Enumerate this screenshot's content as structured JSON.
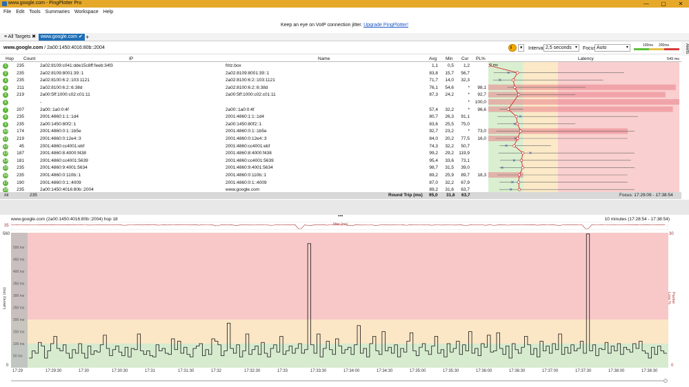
{
  "window": {
    "title": "www.google.com - PingPlotter Pro",
    "controls": [
      "—",
      "▢",
      "✕"
    ]
  },
  "menu": [
    "File",
    "Edit",
    "Tools",
    "Summaries",
    "Workspace",
    "Help"
  ],
  "promo": {
    "text": "Keep an eye on VoIP connection jitter.",
    "link": "Upgrade PingPlotter!"
  },
  "tabs": {
    "all_targets": "All Targets",
    "active": "www.google.com"
  },
  "toolbar": {
    "target_host": "www.google.com",
    "target_ip": "/ 2a00:1450:4016:80b::2004",
    "interval_label": "Interval",
    "interval_value": "2,5 seconds",
    "focus_label": "Focus",
    "focus_value": "Auto",
    "legend_100": "100ms",
    "legend_200": "200ms",
    "alerts": "Alerts"
  },
  "table": {
    "headers": {
      "hop": "Hop",
      "count": "Count",
      "ip": "IP",
      "name": "Name",
      "avg": "Avg",
      "min": "Min",
      "cur": "Cur",
      "pl": "PL%",
      "latency": "Latency",
      "lat_min": "0 ms",
      "lat_max": "549 ms"
    },
    "rows": [
      {
        "hop": "1",
        "count": "235",
        "ip": "2a02:8109:c041:dde15c8ff:feeb:34f3",
        "name": "fritz.box",
        "avg": "1,1",
        "min": "0,5",
        "cur": "1,2",
        "pl": "",
        "avg_ms": 1.1,
        "min_ms": 0.5,
        "cur_ms": 1.2,
        "max_ms": 6,
        "pl_pct": 0
      },
      {
        "hop": "2",
        "count": "235",
        "ip": "2a02:8109:8001:39::1",
        "name": "2a02:8109:8001:39::1",
        "avg": "83,8",
        "min": "15,7",
        "cur": "56,7",
        "pl": "",
        "avg_ms": 83.8,
        "min_ms": 15.7,
        "cur_ms": 56.7,
        "max_ms": 390,
        "pl_pct": 0
      },
      {
        "hop": "3",
        "count": "235",
        "ip": "2a02:8100:6:2::103:1121",
        "name": "2a02:8100:6:2::103:1121",
        "avg": "71,7",
        "min": "14,0",
        "cur": "32,3",
        "pl": "",
        "avg_ms": 71.7,
        "min_ms": 14.0,
        "cur_ms": 32.3,
        "max_ms": 330,
        "pl_pct": 0
      },
      {
        "hop": "4",
        "count": "211",
        "ip": "2a02:8100:6:2::6:38d",
        "name": "2a02:8100:6:2::6:38d",
        "avg": "76,1",
        "min": "54,6",
        "cur": "*",
        "pl": "98,1",
        "avg_ms": 76.1,
        "min_ms": 54.6,
        "cur_ms": null,
        "max_ms": 280,
        "pl_pct": 98.1
      },
      {
        "hop": "5",
        "count": "219",
        "ip": "2a00:5ff:1000:c02:c01:11",
        "name": "2a00:5ff:1000:c02:c01:11",
        "avg": "87,3",
        "min": "24,2",
        "cur": "*",
        "pl": "92,7",
        "avg_ms": 87.3,
        "min_ms": 24.2,
        "cur_ms": null,
        "max_ms": 250,
        "pl_pct": 92.7
      },
      {
        "hop": "6",
        "count": "",
        "ip": "-",
        "name": "",
        "avg": "",
        "min": "",
        "cur": "*",
        "pl": "100,0",
        "avg_ms": null,
        "min_ms": null,
        "cur_ms": null,
        "max_ms": null,
        "pl_pct": 100
      },
      {
        "hop": "7",
        "count": "207",
        "ip": "2a00::1a0:0:4f",
        "name": "2a00::1a0:0:4f",
        "avg": "57,4",
        "min": "32,2",
        "cur": "*",
        "pl": "96,6",
        "avg_ms": 57.4,
        "min_ms": 32.2,
        "cur_ms": null,
        "max_ms": 100,
        "pl_pct": 96.6
      },
      {
        "hop": "8",
        "count": "235",
        "ip": "2001:4860:1:1::1d4",
        "name": "2001:4860:1:1::1d4",
        "avg": "80,7",
        "min": "26,3",
        "cur": "91,1",
        "pl": "",
        "avg_ms": 80.7,
        "min_ms": 26.3,
        "cur_ms": 91.1,
        "max_ms": 430,
        "pl_pct": 0
      },
      {
        "hop": "9",
        "count": "235",
        "ip": "2a00:1450:80f2::1",
        "name": "2a00:1450:80f2::1",
        "avg": "83,6",
        "min": "25,5",
        "cur": "75,0",
        "pl": "",
        "avg_ms": 83.6,
        "min_ms": 25.5,
        "cur_ms": 75.0,
        "max_ms": 250,
        "pl_pct": 0
      },
      {
        "hop": "10",
        "count": "174",
        "ip": "2001:4860:0:1::1b5e",
        "name": "2001:4860:0:1::1b5e",
        "avg": "92,7",
        "min": "23,2",
        "cur": "*",
        "pl": "73,0",
        "avg_ms": 92.7,
        "min_ms": 23.2,
        "cur_ms": null,
        "max_ms": 420,
        "pl_pct": 73.0
      },
      {
        "hop": "11",
        "count": "219",
        "ip": "2001:4860:0:12e4::3",
        "name": "2001:4860:0:12e4::3",
        "avg": "84,0",
        "min": "20,2",
        "cur": "77,5",
        "pl": "16,0",
        "avg_ms": 84.0,
        "min_ms": 20.2,
        "cur_ms": 77.5,
        "max_ms": 400,
        "pl_pct": 16.0
      },
      {
        "hop": "12",
        "count": "45",
        "ip": "2001:4860:cc4001:ebf",
        "name": "2001:4860:cc4001:ebf",
        "avg": "74,3",
        "min": "32,2",
        "cur": "50,7",
        "pl": "",
        "avg_ms": 74.3,
        "min_ms": 32.2,
        "cur_ms": 50.7,
        "max_ms": 180,
        "pl_pct": 0
      },
      {
        "hop": "13",
        "count": "187",
        "ip": "2001:4860:8:4000:f438",
        "name": "2001:4860:8:4000:f438",
        "avg": "99,2",
        "min": "29,2",
        "cur": "119,9",
        "pl": "",
        "avg_ms": 99.2,
        "min_ms": 29.2,
        "cur_ms": 119.9,
        "max_ms": 420,
        "pl_pct": 0
      },
      {
        "hop": "14",
        "count": "181",
        "ip": "2001:4860:cc4001:5639",
        "name": "2001:4860:cc4001:5639",
        "avg": "95,4",
        "min": "33,6",
        "cur": "73,1",
        "pl": "",
        "avg_ms": 95.4,
        "min_ms": 33.6,
        "cur_ms": 73.1,
        "max_ms": 410,
        "pl_pct": 0
      },
      {
        "hop": "15",
        "count": "235",
        "ip": "2001:4860:9:4001:5634",
        "name": "2001:4860:9:4001:5634",
        "avg": "98,7",
        "min": "31,5",
        "cur": "39,0",
        "pl": "",
        "avg_ms": 98.7,
        "min_ms": 31.5,
        "cur_ms": 39.0,
        "max_ms": 420,
        "pl_pct": 0
      },
      {
        "hop": "16",
        "count": "235",
        "ip": "2001:4860:0:110b::1",
        "name": "2001:4860:0:110b::1",
        "avg": "89,2",
        "min": "25,9",
        "cur": "89,7",
        "pl": "18,3",
        "avg_ms": 89.2,
        "min_ms": 25.9,
        "cur_ms": 89.7,
        "max_ms": 400,
        "pl_pct": 18.3
      },
      {
        "hop": "17",
        "count": "190",
        "ip": "2001:4860:0:1::4009",
        "name": "2001:4860:0:1::4009",
        "avg": "87,0",
        "min": "32,2",
        "cur": "67,9",
        "pl": "",
        "avg_ms": 87.0,
        "min_ms": 32.2,
        "cur_ms": 67.9,
        "max_ms": 400,
        "pl_pct": 0
      },
      {
        "hop": "18",
        "count": "235",
        "ip": "2a00:1450:4016:80b::2004",
        "name": "www.google.com",
        "avg": "89,2",
        "min": "31,6",
        "cur": "63,7",
        "pl": "",
        "avg_ms": 89.2,
        "min_ms": 31.6,
        "cur_ms": 63.7,
        "max_ms": 420,
        "pl_pct": 0
      }
    ],
    "summary": {
      "count": "235",
      "label": "Round Trip (ms)",
      "avg": "95,0",
      "min": "31,6",
      "cur": "63,7",
      "focus": "Focus: 17:29:09 - 17:38:54"
    },
    "latency_scale_ms": 549
  },
  "graph": {
    "title": "www.google.com (2a00:1450:4016:80b::2004) hop 18",
    "range": "10 minutes (17:28:54 - 17:38:54)",
    "jitter_label": "Jitter (ms)",
    "jitter_max": "35",
    "y_label": "Latency (ms)",
    "y2_label": "Packet Loss %",
    "y_max": "560",
    "y_min": "0",
    "y2_max": "30",
    "y2_min": "0",
    "y_ticks_inner": [
      "500 ms",
      "450 ms",
      "400 ms",
      "350 ms",
      "300 ms",
      "250 ms",
      "200 ms",
      "150 ms",
      "100 ms",
      "50 ms"
    ],
    "x_ticks": [
      "17:29",
      "17:29:30",
      "17:30",
      "17:30:30",
      "17:31",
      "17:31:30",
      "17:32",
      "17:32:30",
      "17:33",
      "17:33:30",
      "17:34:00",
      "17:34:30",
      "17:35:00",
      "17:35:30",
      "17:36:00",
      "17:36:30",
      "17:37:00",
      "17:37:30",
      "17:38:00",
      "17:38:30"
    ]
  },
  "chart_data": {
    "type": "line",
    "title": "www.google.com (2a00:1450:4016:80b::2004) hop 18",
    "ylabel": "Latency (ms)",
    "ylim": [
      0,
      560
    ],
    "x_start": "17:28:54",
    "x_end": "17:38:54",
    "zones": [
      {
        "name": "good",
        "max": 100,
        "color": "#d7ebcf"
      },
      {
        "name": "warn",
        "max": 200,
        "color": "#fbe6c6"
      },
      {
        "name": "bad",
        "max": 560,
        "color": "#f8c8c8"
      }
    ],
    "values": [
      40,
      70,
      60,
      105,
      90,
      40,
      70,
      100,
      130,
      80,
      70,
      95,
      60,
      40,
      75,
      60,
      100,
      60,
      40,
      90,
      55,
      70,
      65,
      95,
      135,
      80,
      50,
      75,
      90,
      65,
      50,
      85,
      45,
      80,
      75,
      140,
      70,
      55,
      70,
      50,
      45,
      95,
      70,
      80,
      60,
      55,
      120,
      75,
      110,
      60,
      85,
      55,
      45,
      80,
      90,
      100,
      50,
      75,
      55,
      120,
      110,
      95,
      50,
      70,
      185,
      80,
      60,
      95,
      45,
      70,
      140,
      55,
      75,
      90,
      55,
      105,
      60,
      45,
      80,
      95,
      65,
      130,
      55,
      70,
      90,
      60,
      80,
      100,
      60,
      75,
      515,
      95,
      60,
      140,
      45,
      80,
      110,
      75,
      55,
      120,
      90,
      60,
      75,
      85,
      55,
      95,
      175,
      60,
      80,
      45,
      100,
      130,
      70,
      55,
      150,
      70,
      85,
      60,
      95,
      45,
      80,
      65,
      110,
      145,
      70,
      50,
      85,
      100,
      70,
      55,
      90,
      130,
      60,
      75,
      45,
      100,
      65,
      80,
      110,
      55,
      95,
      70,
      150,
      60,
      80,
      50,
      100,
      85,
      135,
      65,
      70,
      145,
      80,
      55,
      90,
      40,
      100,
      75,
      60,
      85,
      130,
      95,
      55,
      80,
      45,
      110,
      70,
      90,
      60,
      100,
      75,
      140,
      55,
      85,
      60,
      95,
      70,
      80,
      110,
      60,
      555,
      70,
      95,
      50,
      80,
      75,
      105,
      60,
      90,
      70,
      100,
      55,
      85,
      75,
      65,
      100,
      80,
      110,
      70,
      60,
      40,
      85,
      55,
      90,
      70,
      60
    ]
  }
}
